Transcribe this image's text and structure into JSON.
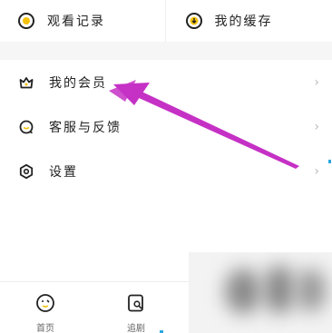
{
  "quick_row": {
    "history_label": "观看记录",
    "cache_label": "我的缓存"
  },
  "menu": {
    "items": [
      {
        "label": "我的会员",
        "icon": "crown-icon"
      },
      {
        "label": "客服与反馈",
        "icon": "chat-icon"
      },
      {
        "label": "设置",
        "icon": "gear-icon"
      }
    ],
    "chevron": "›"
  },
  "bottom_nav": {
    "items": [
      {
        "label": "首页",
        "icon": "home-face-icon"
      },
      {
        "label": "追剧",
        "icon": "video-search-icon"
      }
    ]
  },
  "colors": {
    "accent_yellow": "#f4c20d",
    "annotation_arrow": "#c531c5",
    "chevron": "#bbbbbb",
    "separator": "#f6f6f6"
  }
}
